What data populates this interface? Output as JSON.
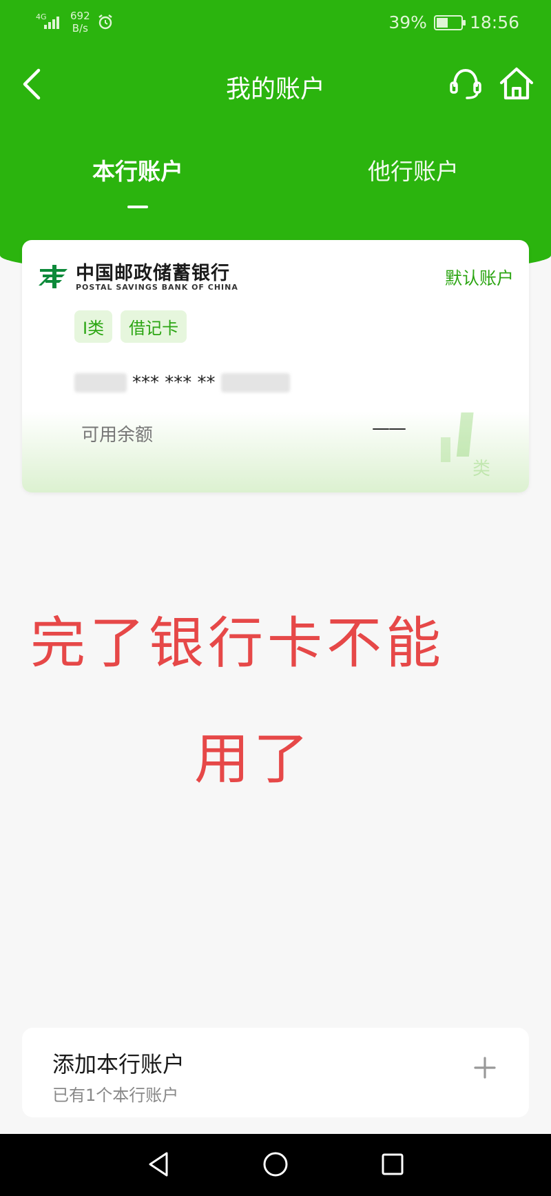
{
  "status_bar": {
    "network": "4G",
    "speed": "692",
    "speed_unit": "B/s",
    "battery": "39%",
    "time": "18:56"
  },
  "nav": {
    "title": "我的账户",
    "icons": [
      "back-arrow-icon",
      "customer-service-icon",
      "home-icon"
    ]
  },
  "tabs": [
    {
      "label": "本行账户",
      "active": true
    },
    {
      "label": "他行账户",
      "active": false
    }
  ],
  "account_card": {
    "bank_name_cn": "中国邮政储蓄银行",
    "bank_name_en": "POSTAL SAVINGS BANK OF CHINA",
    "default_label": "默认账户",
    "badges": [
      "I类",
      "借记卡"
    ],
    "card_number_masked": "*** *** **",
    "balance_label": "可用余额",
    "balance_value": "——"
  },
  "overlay_text": {
    "line1": "完了银行卡不能",
    "line2": "用了"
  },
  "add_account": {
    "title": "添加本行账户",
    "subtitle": "已有1个本行账户"
  },
  "colors": {
    "primary_green": "#2bb40e",
    "accent_green": "#2ca513",
    "badge_bg": "#e6f6dd",
    "overlay_red": "#e64848"
  }
}
